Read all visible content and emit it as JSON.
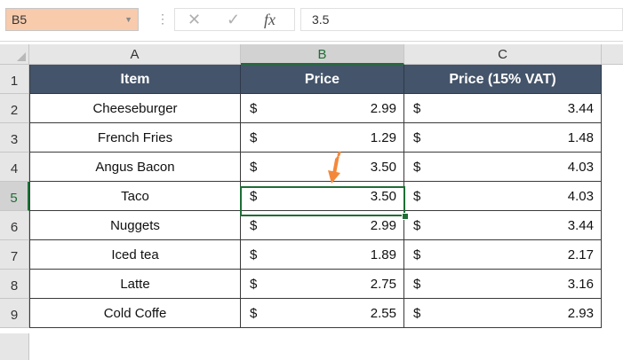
{
  "formula_bar": {
    "name_box": "B5",
    "formula_value": "3.5",
    "fx_label": "fx"
  },
  "columns": [
    "A",
    "B",
    "C"
  ],
  "rows": [
    "1",
    "2",
    "3",
    "4",
    "5",
    "6",
    "7",
    "8",
    "9"
  ],
  "table": {
    "headers": [
      "Item",
      "Price",
      "Price (15% VAT)"
    ],
    "currency": "$",
    "body": [
      {
        "item": "Cheeseburger",
        "price": "2.99",
        "vat": "3.44"
      },
      {
        "item": "French Fries",
        "price": "1.29",
        "vat": "1.48"
      },
      {
        "item": "Angus Bacon",
        "price": "3.50",
        "vat": "4.03"
      },
      {
        "item": "Taco",
        "price": "3.50",
        "vat": "4.03"
      },
      {
        "item": "Nuggets",
        "price": "2.99",
        "vat": "3.44"
      },
      {
        "item": "Iced tea",
        "price": "1.89",
        "vat": "2.17"
      },
      {
        "item": "Latte",
        "price": "2.75",
        "vat": "3.16"
      },
      {
        "item": "Cold Coffe",
        "price": "2.55",
        "vat": "2.93"
      }
    ]
  },
  "colors": {
    "header_fill": "#44546a",
    "selection": "#1e6e36",
    "name_box_fill": "#f8cbad",
    "arrow": "#f4883a"
  },
  "icons": [
    "chevron-down-icon",
    "cancel-icon",
    "confirm-icon",
    "function-icon"
  ]
}
